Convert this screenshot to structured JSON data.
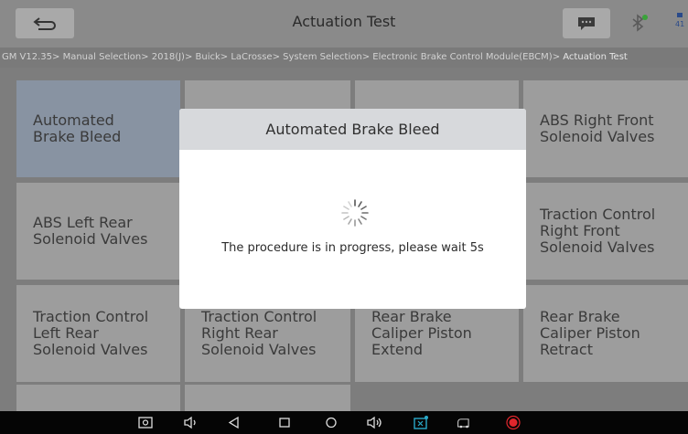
{
  "header": {
    "title": "Actuation Test",
    "status_text": "41"
  },
  "breadcrumb": {
    "path": "GM V12.35> Manual Selection> 2018(J)> Buick> LaCrosse> System Selection> Electronic Brake Control Module(EBCM)> ",
    "current": "Actuation Test"
  },
  "tiles": [
    {
      "l1": "Automated",
      "l2": "Brake Bleed",
      "l3": ""
    },
    {
      "l1": "",
      "l2": "",
      "l3": ""
    },
    {
      "l1": "",
      "l2": "",
      "l3": ""
    },
    {
      "l1": "ABS Right Front",
      "l2": "Solenoid Valves",
      "l3": ""
    },
    {
      "l1": "ABS Left Rear",
      "l2": "Solenoid Valves",
      "l3": ""
    },
    {
      "l1": "",
      "l2": "",
      "l3": ""
    },
    {
      "l1": "",
      "l2": "",
      "l3": ""
    },
    {
      "l1": "Traction Control",
      "l2": "Right Front",
      "l3": "Solenoid Valves"
    },
    {
      "l1": "Traction Control",
      "l2": "Left Rear",
      "l3": "Solenoid Valves"
    },
    {
      "l1": "Traction Control",
      "l2": "Right Rear",
      "l3": "Solenoid Valves"
    },
    {
      "l1": "Rear Brake",
      "l2": "Caliper Piston",
      "l3": "Extend"
    },
    {
      "l1": "Rear Brake",
      "l2": "Caliper Piston",
      "l3": "Retract"
    }
  ],
  "dialog": {
    "title": "Automated Brake Bleed",
    "message": "The procedure is in progress, please wait 5s"
  },
  "colors": {
    "overlay_dim": "#7d7d7d",
    "selected_tile": "#8893a2",
    "record_red": "#e0262c"
  },
  "navbar": {
    "icons": [
      "screenshot-icon",
      "volume-down-icon",
      "back-triangle-icon",
      "home-square-icon",
      "home-circle-icon",
      "volume-up-icon",
      "diagnostic-app-icon",
      "vci-icon",
      "record-icon"
    ]
  }
}
